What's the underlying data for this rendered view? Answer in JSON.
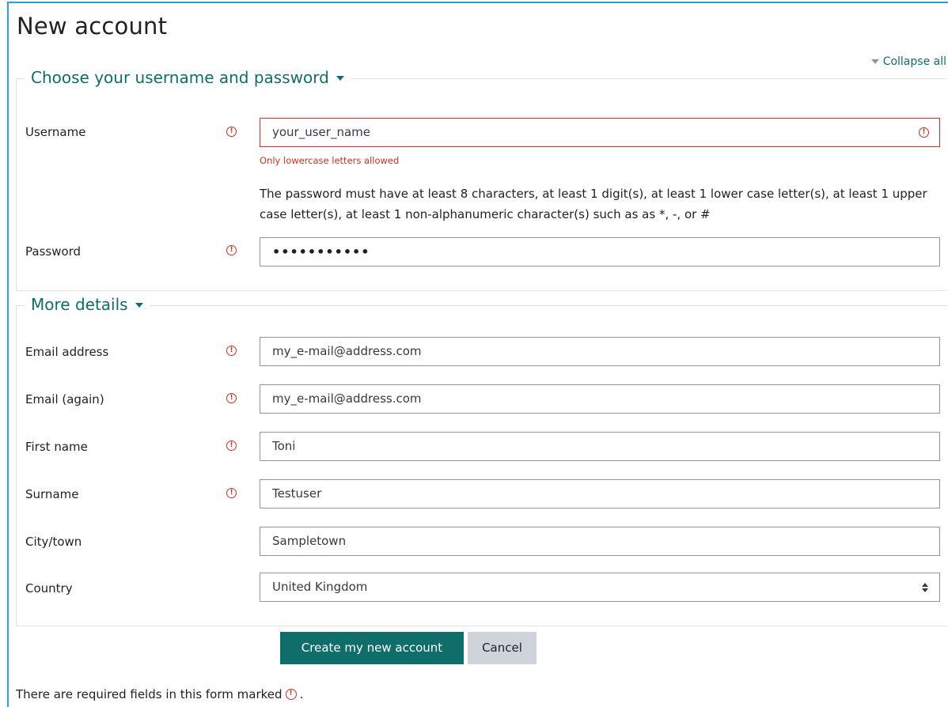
{
  "page": {
    "title": "New account",
    "collapse_all": "Collapse all"
  },
  "section_account": {
    "legend": "Choose your username and password",
    "username": {
      "label": "Username",
      "value": "your_user_name",
      "error": "Only lowercase letters allowed"
    },
    "password_policy": "The password must have at least 8 characters, at least 1 digit(s), at least 1 lower case letter(s), at least 1 upper case letter(s), at least 1 non-alphanumeric character(s) such as as *, -, or #",
    "password": {
      "label": "Password",
      "value": "•••••••••••"
    }
  },
  "section_details": {
    "legend": "More details",
    "email": {
      "label": "Email address",
      "value": "my_e-mail@address.com"
    },
    "email_again": {
      "label": "Email (again)",
      "value": "my_e-mail@address.com"
    },
    "first_name": {
      "label": "First name",
      "value": "Toni"
    },
    "surname": {
      "label": "Surname",
      "value": "Testuser"
    },
    "city": {
      "label": "City/town",
      "value": "Sampletown"
    },
    "country": {
      "label": "Country",
      "value": "United Kingdom"
    }
  },
  "buttons": {
    "create": "Create my new account",
    "cancel": "Cancel"
  },
  "footer": {
    "required_note_prefix": "There are required fields in this form marked",
    "required_note_suffix": "."
  },
  "icons": {
    "required": "exclamation-circle-icon",
    "collapse": "caret-down-icon",
    "select": "sort-arrows-icon"
  },
  "colors": {
    "accent": "#0f6e6a",
    "error": "#ca3120",
    "frame": "#2aa0d6",
    "secondary_button": "#ced4da"
  }
}
